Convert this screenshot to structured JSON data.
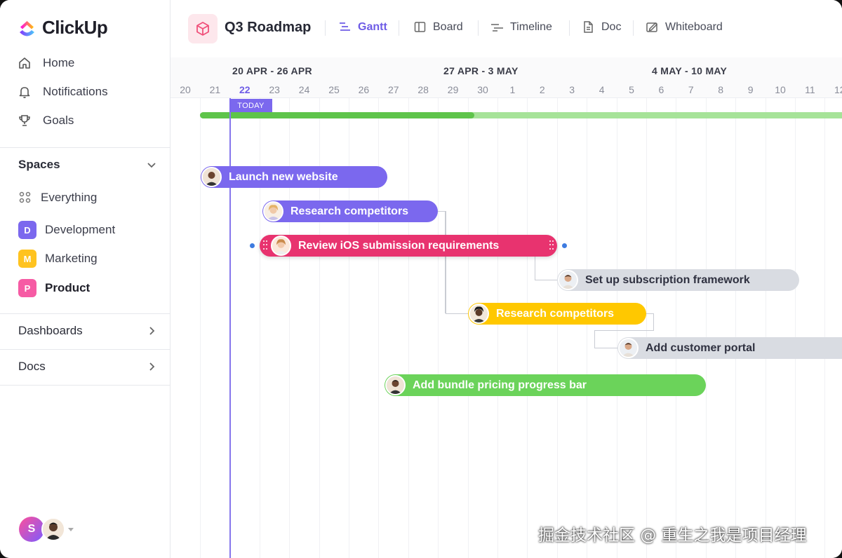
{
  "app": {
    "name": "ClickUp"
  },
  "sidebar": {
    "nav": [
      {
        "label": "Home",
        "icon": "home-icon"
      },
      {
        "label": "Notifications",
        "icon": "bell-icon"
      },
      {
        "label": "Goals",
        "icon": "trophy-icon"
      }
    ],
    "spaces_label": "Spaces",
    "everything_label": "Everything",
    "spaces": [
      {
        "letter": "D",
        "label": "Development",
        "color": "#7b68ee"
      },
      {
        "letter": "M",
        "label": "Marketing",
        "color": "#ffc31f"
      },
      {
        "letter": "P",
        "label": "Product",
        "color": "#f65ba4"
      }
    ],
    "dashboards_label": "Dashboards",
    "docs_label": "Docs",
    "user_initial": "S"
  },
  "topbar": {
    "project_title": "Q3 Roadmap",
    "views": [
      {
        "label": "Gantt",
        "icon": "gantt-icon",
        "active": true
      },
      {
        "label": "Board",
        "icon": "board-icon"
      },
      {
        "label": "Timeline",
        "icon": "timeline-icon"
      },
      {
        "label": "Doc",
        "icon": "doc-icon"
      },
      {
        "label": "Whiteboard",
        "icon": "whiteboard-icon"
      }
    ]
  },
  "gantt": {
    "weeks": [
      "20 APR - 26 APR",
      "27 APR - 3 MAY",
      "4 MAY - 10 MAY"
    ],
    "days": [
      "20",
      "21",
      "22",
      "23",
      "24",
      "25",
      "26",
      "27",
      "28",
      "29",
      "30",
      "1",
      "2",
      "3",
      "4",
      "5",
      "6",
      "7",
      "8",
      "9",
      "10",
      "11",
      "12"
    ],
    "today_label": "TODAY",
    "progress_percent": 42,
    "tasks": [
      {
        "label": "Launch new website",
        "color": "#7b68ee"
      },
      {
        "label": "Research competitors",
        "color": "#7b68ee"
      },
      {
        "label": "Review iOS submission requirements",
        "color": "#e8336f"
      },
      {
        "label": "Set up subscription framework",
        "color": "#d9dce2"
      },
      {
        "label": "Research competitors",
        "color": "#ffc800"
      },
      {
        "label": "Add customer portal",
        "color": "#d9dce2"
      },
      {
        "label": "Add bundle pricing progress bar",
        "color": "#6bd35a"
      }
    ]
  },
  "watermark": "掘金技术社区 @ 重生之我是项目经理"
}
